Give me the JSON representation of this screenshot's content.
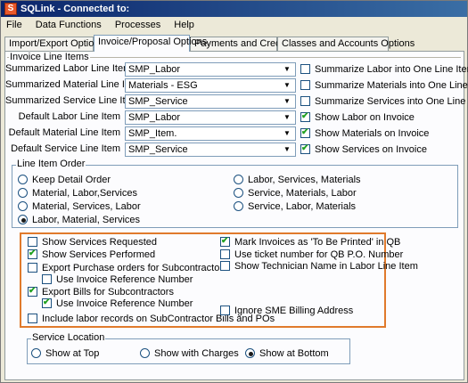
{
  "window": {
    "title": "SQLink - Connected to:"
  },
  "menu": [
    {
      "label": "File"
    },
    {
      "label": "Data Functions"
    },
    {
      "label": "Processes"
    },
    {
      "label": "Help"
    }
  ],
  "tabs": [
    {
      "label": "Import/Export Options",
      "active": false
    },
    {
      "label": "Invoice/Proposal Options",
      "active": true
    },
    {
      "label": "Payments and Credits",
      "active": false
    },
    {
      "label": "Classes and Accounts Options",
      "active": false
    }
  ],
  "invoice_line_items": {
    "title": "Invoice Line Items",
    "rows": [
      {
        "label": "Summarized Labor Line Item",
        "value": "SMP_Labor",
        "check_label": "Summarize Labor into One Line Item",
        "checked": false
      },
      {
        "label": "Summarized Material Line Item",
        "value": "Materials - ESG",
        "check_label": "Summarize Materials into One Line Item",
        "checked": false
      },
      {
        "label": "Summarized Service Line Item",
        "value": "SMP_Service",
        "check_label": "Summarize Services into One Line Item",
        "checked": false
      },
      {
        "label": "Default Labor Line Item",
        "value": "SMP_Labor",
        "check_label": "Show Labor on Invoice",
        "checked": true
      },
      {
        "label": "Default Material Line Item",
        "value": "SMP_Item.",
        "check_label": "Show Materials on Invoice",
        "checked": true
      },
      {
        "label": "Default Service Line Item",
        "value": "SMP_Service",
        "check_label": "Show Services on Invoice",
        "checked": true
      }
    ]
  },
  "line_item_order": {
    "title": "Line Item Order",
    "options": [
      {
        "label": "Keep Detail Order",
        "selected": false
      },
      {
        "label": "Material, Labor,Services",
        "selected": false
      },
      {
        "label": "Material, Services, Labor",
        "selected": false
      },
      {
        "label": "Labor, Material, Services",
        "selected": true
      },
      {
        "label": "Labor, Services, Materials",
        "selected": false
      },
      {
        "label": "Service, Materials, Labor",
        "selected": false
      },
      {
        "label": "Service, Labor, Materials",
        "selected": false
      }
    ]
  },
  "options_left": [
    {
      "label": "Show Services Requested",
      "checked": false
    },
    {
      "label": "Show Services Performed",
      "checked": true
    },
    {
      "label": "Export Purchase orders for Subcontractors",
      "checked": false
    },
    {
      "label": "Use Invoice Reference Number",
      "checked": false
    },
    {
      "label": "Export Bills for Subcontractors",
      "checked": true
    },
    {
      "label": "Use Invoice Reference Number",
      "checked": true
    },
    {
      "label": "Include labor records on SubContractor Bills and POs",
      "checked": false
    }
  ],
  "options_right": [
    {
      "label": "Mark Invoices as 'To Be Printed' in QB",
      "checked": true
    },
    {
      "label": "Use ticket number for QB P.O. Number",
      "checked": false
    },
    {
      "label": "Show Technician Name in Labor Line Item",
      "checked": false
    },
    {
      "label": "Ignore SME Billing Address",
      "checked": false
    }
  ],
  "service_location": {
    "title": "Service Location",
    "options": [
      {
        "label": "Show at Top",
        "selected": false
      },
      {
        "label": "Show with Charges",
        "selected": false
      },
      {
        "label": "Show at Bottom",
        "selected": true
      }
    ]
  },
  "colors": {
    "accent": "#e07a2c",
    "check": "#21a121",
    "title_bar": "#0a246a"
  }
}
